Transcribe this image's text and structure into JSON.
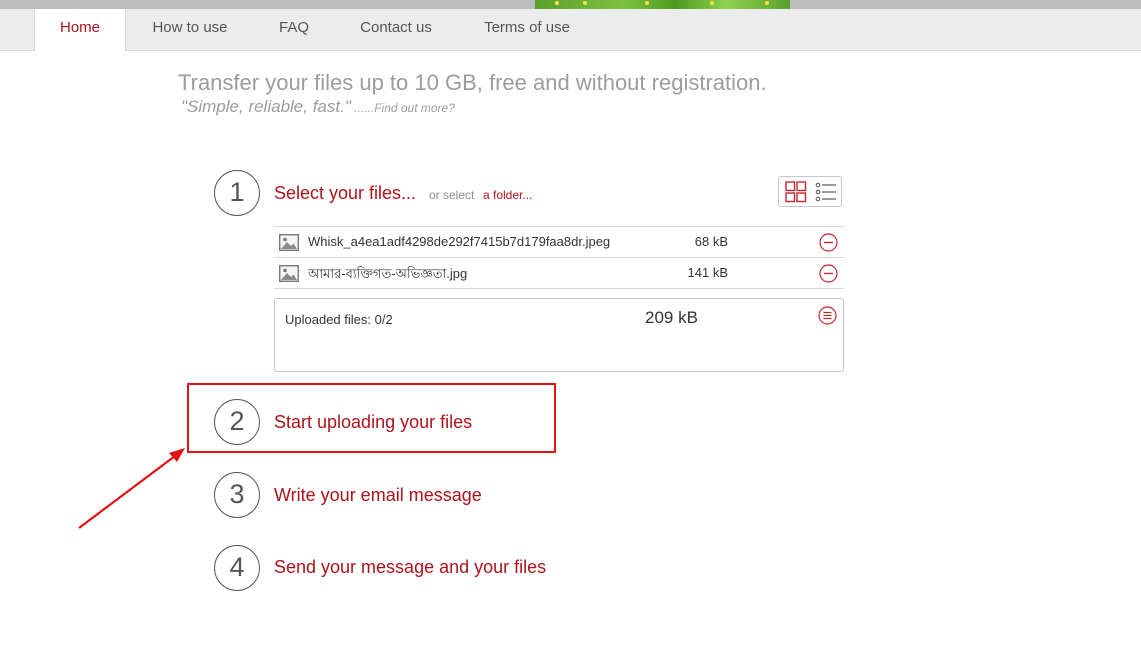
{
  "header": {
    "nav": [
      {
        "label": "Home",
        "active": true
      },
      {
        "label": "How to use"
      },
      {
        "label": "FAQ"
      },
      {
        "label": "Contact us"
      },
      {
        "label": "Terms of use"
      }
    ]
  },
  "intro": {
    "tagline": "Transfer your files up to 10 GB, free and without registration.",
    "slogan": "\"Simple, reliable, fast.\"",
    "find_out_more": " ......Find out more?"
  },
  "steps": [
    {
      "number": "1",
      "label": "Select your files..."
    },
    {
      "number": "2",
      "label": "Start uploading your files"
    },
    {
      "number": "3",
      "label": "Write your email message"
    },
    {
      "number": "4",
      "label": "Send your message and your files"
    }
  ],
  "select": {
    "or_select": "or select",
    "folder_link": "a folder..."
  },
  "view_toggle": {
    "grid_icon": "grid-view-icon",
    "list_icon": "list-view-icon"
  },
  "files": [
    {
      "name": "Whisk_a4ea1adf4298de292f7415b7d179faa8dr.jpeg",
      "size": "68 kB",
      "icon": "image-file-icon"
    },
    {
      "name": "আমার-ব্যক্তিগত-অভিজ্ঞতা.jpg",
      "size": "141 kB",
      "icon": "image-file-icon"
    }
  ],
  "summary": {
    "uploaded_label": "Uploaded files: 0/2",
    "total_size": "209 kB"
  },
  "colors": {
    "accent": "#b0121b",
    "highlight": "#e01212",
    "nav_background": "#ececec",
    "muted_text": "#9c9c9c"
  }
}
